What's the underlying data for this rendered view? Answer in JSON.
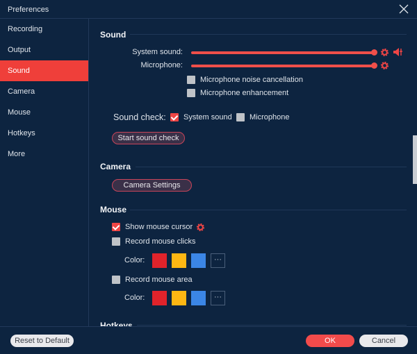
{
  "window": {
    "title": "Preferences"
  },
  "sidebar": {
    "items": [
      {
        "label": "Recording"
      },
      {
        "label": "Output"
      },
      {
        "label": "Sound",
        "active": true
      },
      {
        "label": "Camera"
      },
      {
        "label": "Mouse"
      },
      {
        "label": "Hotkeys"
      },
      {
        "label": "More"
      }
    ]
  },
  "sound": {
    "title": "Sound",
    "system_sound_label": "System sound:",
    "system_sound_level": 100,
    "microphone_label": "Microphone:",
    "microphone_level": 100,
    "noise_cancel": {
      "label": "Microphone noise cancellation",
      "checked": false
    },
    "enhancement": {
      "label": "Microphone enhancement",
      "checked": false
    },
    "sound_check_label": "Sound check:",
    "check_system": {
      "label": "System sound",
      "checked": true
    },
    "check_mic": {
      "label": "Microphone",
      "checked": false
    },
    "start_button": "Start sound check"
  },
  "camera": {
    "title": "Camera",
    "settings_button": "Camera Settings"
  },
  "mouse": {
    "title": "Mouse",
    "show_cursor": {
      "label": "Show mouse cursor",
      "checked": true
    },
    "record_clicks": {
      "label": "Record mouse clicks",
      "checked": false
    },
    "record_area": {
      "label": "Record mouse area",
      "checked": false
    },
    "color_label": "Color:",
    "more_label": "···",
    "colors": [
      "#e0232b",
      "#fdb713",
      "#3b86e6"
    ]
  },
  "hotkeys": {
    "title": "Hotkeys"
  },
  "footer": {
    "reset": "Reset to Default",
    "ok": "OK",
    "cancel": "Cancel"
  },
  "accent": "#ef4545"
}
